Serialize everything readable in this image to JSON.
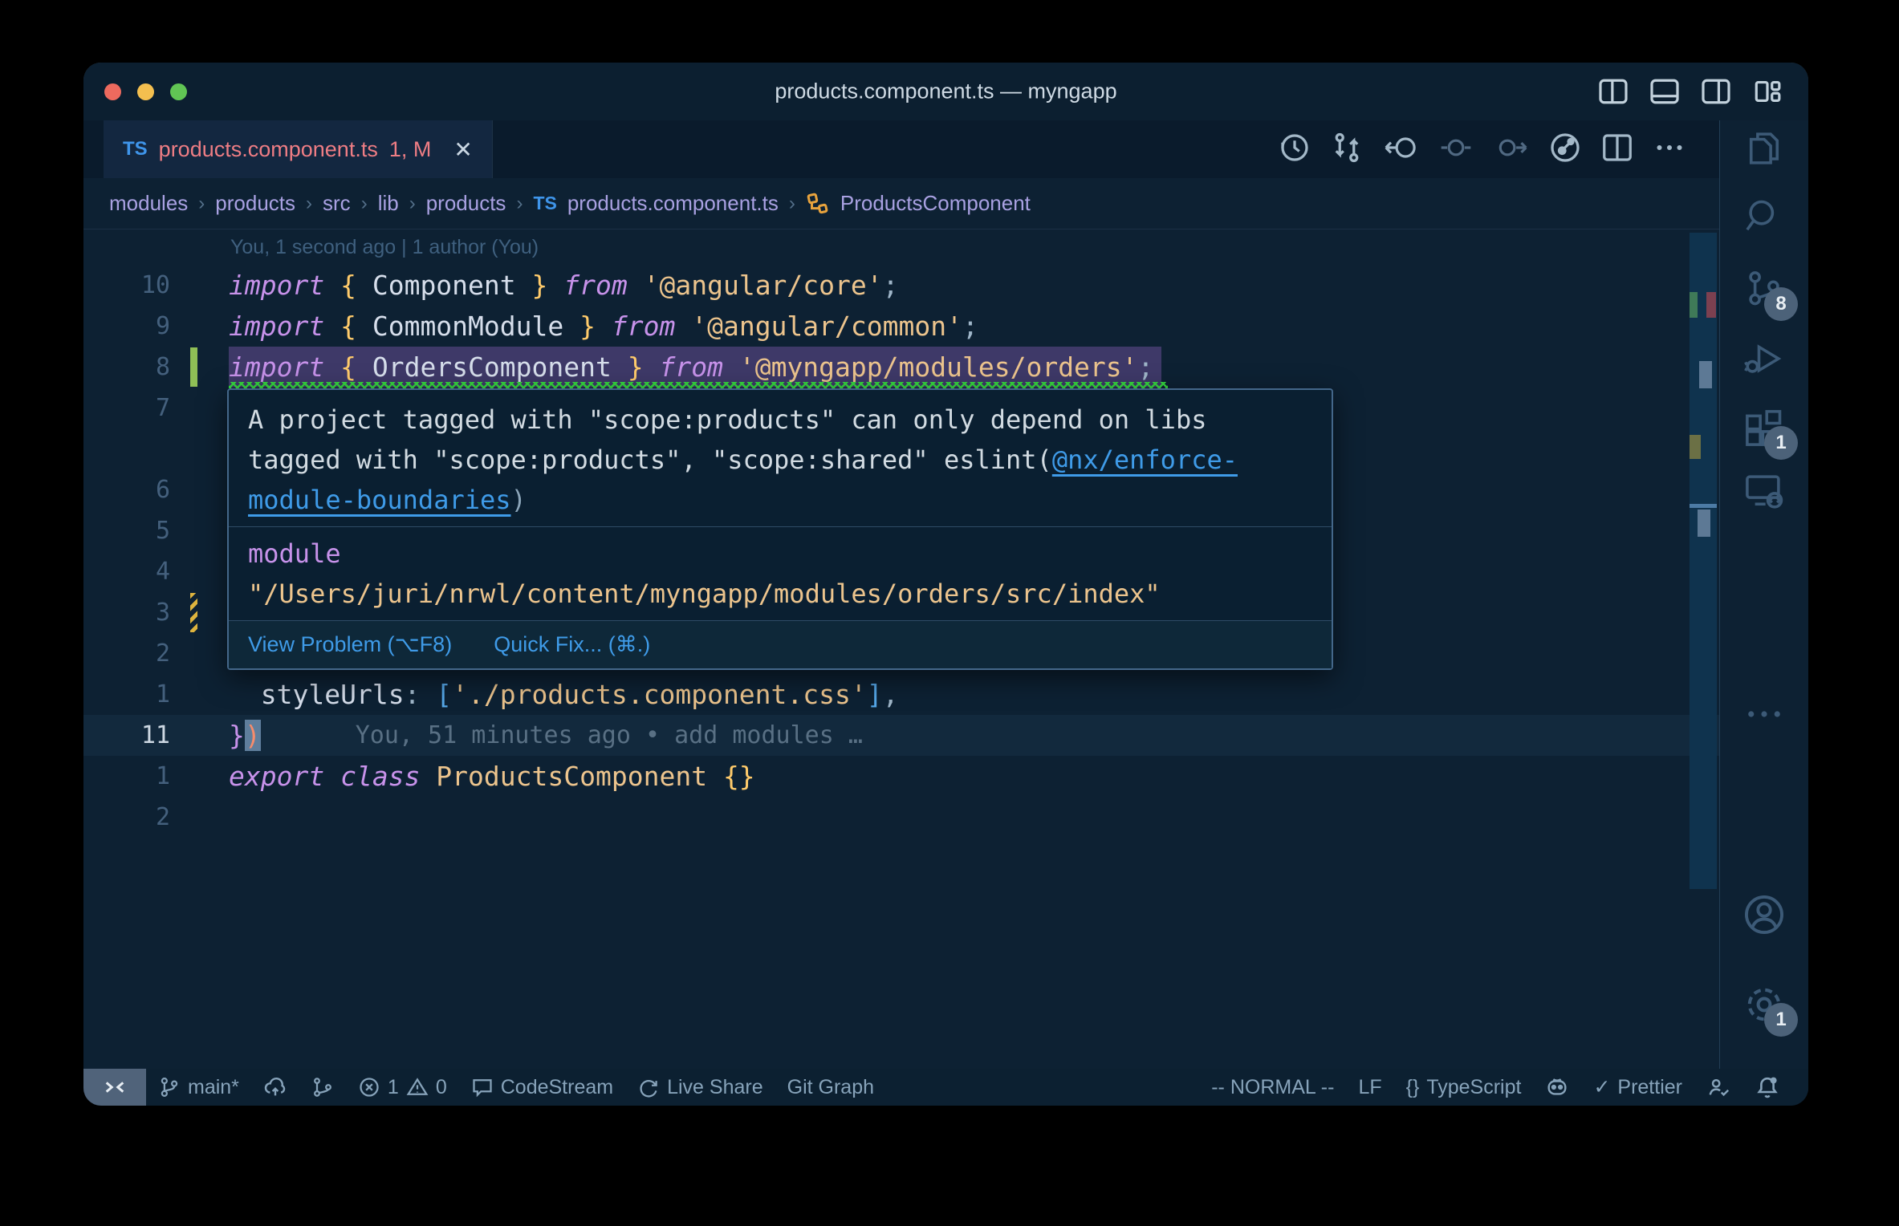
{
  "window": {
    "title": "products.component.ts — myngapp"
  },
  "tab": {
    "language_badge": "TS",
    "label": "products.component.ts",
    "decoration": "1, M",
    "close": "✕"
  },
  "editor_actions": [
    "timeline",
    "open-changes",
    "go-back",
    "previous-change",
    "next-change",
    "commit-graph",
    "split-editor",
    "more-actions"
  ],
  "breadcrumb": {
    "items": [
      "modules",
      "products",
      "src",
      "lib",
      "products"
    ],
    "file_badge": "TS",
    "file_label": "products.component.ts",
    "symbol": "ProductsComponent"
  },
  "editor": {
    "blame_header": "You, 1 second ago | 1 author (You)",
    "lines": [
      {
        "n": "10",
        "t": [
          [
            "k",
            "import"
          ],
          [
            "p",
            " "
          ],
          [
            "b",
            "{"
          ],
          [
            "i",
            " Component "
          ],
          [
            "b",
            "}"
          ],
          [
            "p",
            " "
          ],
          [
            "k",
            "from"
          ],
          [
            "s",
            " '@angular/core'"
          ],
          [
            "p",
            ";"
          ]
        ]
      },
      {
        "n": "9",
        "t": [
          [
            "k",
            "import"
          ],
          [
            "p",
            " "
          ],
          [
            "b",
            "{"
          ],
          [
            "i",
            " CommonModule "
          ],
          [
            "b",
            "}"
          ],
          [
            "p",
            " "
          ],
          [
            "k",
            "from"
          ],
          [
            "s",
            " '@angular/common'"
          ],
          [
            "p",
            ";"
          ]
        ]
      },
      {
        "n": "8",
        "sel": true,
        "sq": true,
        "g": "green",
        "t": [
          [
            "k",
            "import"
          ],
          [
            "p",
            " "
          ],
          [
            "b",
            "{"
          ],
          [
            "i",
            " OrdersComponent "
          ],
          [
            "b",
            "}"
          ],
          [
            "p",
            " "
          ],
          [
            "k",
            "from"
          ],
          [
            "s",
            " '@myngapp/modules/orders'"
          ],
          [
            "p",
            ";"
          ]
        ]
      },
      {
        "n": "7"
      },
      {
        "sp": true
      },
      {
        "n": "6"
      },
      {
        "n": "5"
      },
      {
        "n": "4"
      },
      {
        "n": "3",
        "g": "yellow"
      },
      {
        "n": "2"
      },
      {
        "n": "1",
        "t": [
          [
            "p",
            "  "
          ],
          [
            "i",
            "styleUrls"
          ],
          [
            "p",
            ":"
          ],
          [
            "bb",
            " ["
          ],
          [
            "s",
            "'./products.component.css'"
          ],
          [
            "bb",
            "]"
          ],
          [
            "p",
            ","
          ]
        ]
      },
      {
        "n": "11",
        "active": true,
        "cur": true,
        "t": [
          [
            "kn",
            "}"
          ],
          [
            "cur",
            ")"
          ]
        ],
        "blame": "You, 51 minutes ago • add modules …"
      },
      {
        "n": "1",
        "t": [
          [
            "k",
            "export"
          ],
          [
            "p",
            " "
          ],
          [
            "k",
            "class"
          ],
          [
            "s",
            " ProductsComponent "
          ],
          [
            "b",
            "{}"
          ]
        ]
      },
      {
        "n": "2"
      }
    ]
  },
  "popup": {
    "message_lines": [
      [
        [
          "m",
          "A project tagged with \"scope:products\" can only depend on libs"
        ]
      ],
      [
        [
          "m",
          "tagged with \"scope:products\", \"scope:shared\" eslint("
        ],
        [
          "l",
          "@nx/enforce-"
        ]
      ],
      [
        [
          "l",
          "module-boundaries"
        ],
        [
          "d",
          ")"
        ]
      ]
    ],
    "module_keyword": "module",
    "module_path": "\"/Users/juri/nrwl/content/myngapp/modules/orders/src/index\"",
    "action_view_problem": "View Problem (⌥F8)",
    "action_quick_fix": "Quick Fix... (⌘.)"
  },
  "activity_bar": {
    "items": [
      "explorer",
      "search",
      "source-control",
      "run-and-debug",
      "extensions",
      "remote-explorer",
      "more",
      "accounts",
      "settings"
    ],
    "scm_badge": "8",
    "extensions_badge": "1",
    "settings_badge": "1"
  },
  "statusbar": {
    "branch": "main*",
    "errors": "1",
    "warnings": "0",
    "codestream": "CodeStream",
    "liveshare": "Live Share",
    "gitgraph": "Git Graph",
    "mode": "-- NORMAL --",
    "eol": "LF",
    "language_braces": "{}",
    "language": "TypeScript",
    "prettier_check": "✓",
    "prettier": "Prettier"
  },
  "colors": {
    "editor_bg": "#0d2133",
    "titlebar_bg": "#0c1f30",
    "tab_bg": "#132740",
    "error_coral": "#ee7d84",
    "keyword_purple": "#c792ea",
    "string_tan": "#ecc48d",
    "brace_gold": "#ffcb6b",
    "bracket_blue": "#55a7e8",
    "squiggle_green": "#36d93f",
    "selection_purple": "#3e3968",
    "link_blue": "#3f9be8",
    "breadcrumb_lavender": "#a9a1e2",
    "traffic_red": "#ed6a5e",
    "traffic_yellow": "#f4bf4f",
    "traffic_green": "#61c554"
  }
}
